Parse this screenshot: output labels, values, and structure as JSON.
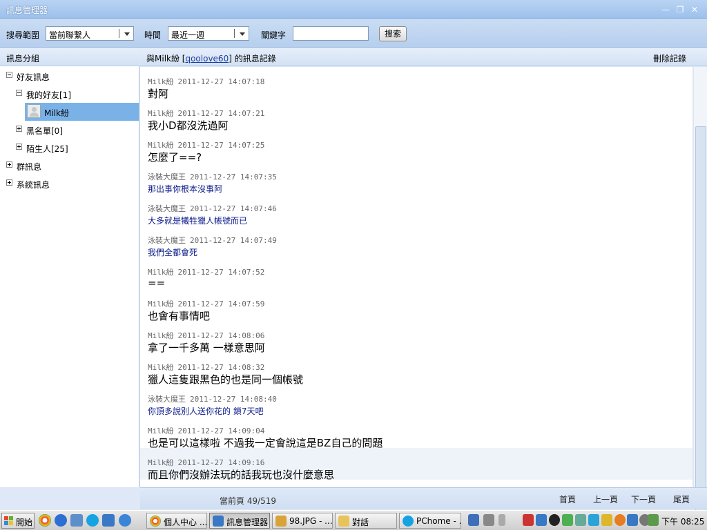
{
  "window": {
    "title": "訊息管理器",
    "minimize_icon": "minimize-icon",
    "maximize_icon": "restore-icon",
    "close_icon": "close-icon"
  },
  "search": {
    "scope_label": "搜尋範圍",
    "scope_value": "當前聯繫人",
    "time_label": "時間",
    "time_value": "最近一週",
    "keyword_label": "關鍵字",
    "keyword_value": "",
    "search_button": "搜索"
  },
  "sidebar": {
    "header": "訊息分組",
    "tree": {
      "friends_msgs": "好友訊息",
      "my_friends": "我的好友[1]",
      "contact": "Milk紛",
      "blacklist": "黑名單[0]",
      "strangers": "陌生人[25]",
      "group_msgs": "群訊息",
      "system_msgs": "系統訊息"
    }
  },
  "chat": {
    "header_prefix": "與Milk紛 [",
    "header_link": "qoolove60",
    "header_suffix": "] 的訊息記錄",
    "delete_button": "刪除記錄",
    "messages": [
      {
        "sender": "Milk紛",
        "time": "2011-12-27 14:07:18",
        "text": "對阿",
        "me": false
      },
      {
        "sender": "Milk紛",
        "time": "2011-12-27 14:07:21",
        "text": "我小D都沒洗過阿",
        "me": false
      },
      {
        "sender": "Milk紛",
        "time": "2011-12-27 14:07:25",
        "text": "怎麼了==?",
        "me": false
      },
      {
        "sender": "泳裝大魔王",
        "time": "2011-12-27 14:07:35",
        "text": "那出事你根本沒事阿",
        "me": true
      },
      {
        "sender": "泳裝大魔王",
        "time": "2011-12-27 14:07:46",
        "text": "大多就是犧牲獵人帳號而已",
        "me": true
      },
      {
        "sender": "泳裝大魔王",
        "time": "2011-12-27 14:07:49",
        "text": "我們全都會死",
        "me": true
      },
      {
        "sender": "Milk紛",
        "time": "2011-12-27 14:07:52",
        "text": "==",
        "me": false
      },
      {
        "sender": "Milk紛",
        "time": "2011-12-27 14:07:59",
        "text": "也會有事情吧",
        "me": false
      },
      {
        "sender": "Milk紛",
        "time": "2011-12-27 14:08:06",
        "text": "拿了一千多萬 一樣意思阿",
        "me": false
      },
      {
        "sender": "Milk紛",
        "time": "2011-12-27 14:08:32",
        "text": "獵人這隻跟黑色的也是同一個帳號",
        "me": false
      },
      {
        "sender": "泳裝大魔王",
        "time": "2011-12-27 14:08:40",
        "text": "你頂多說別人送你花的 鎖7天吧",
        "me": true
      },
      {
        "sender": "Milk紛",
        "time": "2011-12-27 14:09:04",
        "text": "也是可以這樣啦 不過我一定會說這是BZ自己的問題",
        "me": false
      },
      {
        "sender": "Milk紛",
        "time": "2011-12-27 14:09:16",
        "text": "而且你們沒辦法玩的話我玩也沒什麼意思",
        "me": false
      }
    ]
  },
  "pager": {
    "current_page": "當前頁 49/519",
    "first": "首頁",
    "prev": "上一頁",
    "next": "下一頁",
    "last": "尾頁"
  },
  "taskbar": {
    "start": "開始",
    "tasks": [
      "個人中心 ...",
      "訊息管理器",
      "98.JPG - ...",
      "對話",
      "PChome - ..."
    ],
    "clock": "下午 08:25"
  }
}
